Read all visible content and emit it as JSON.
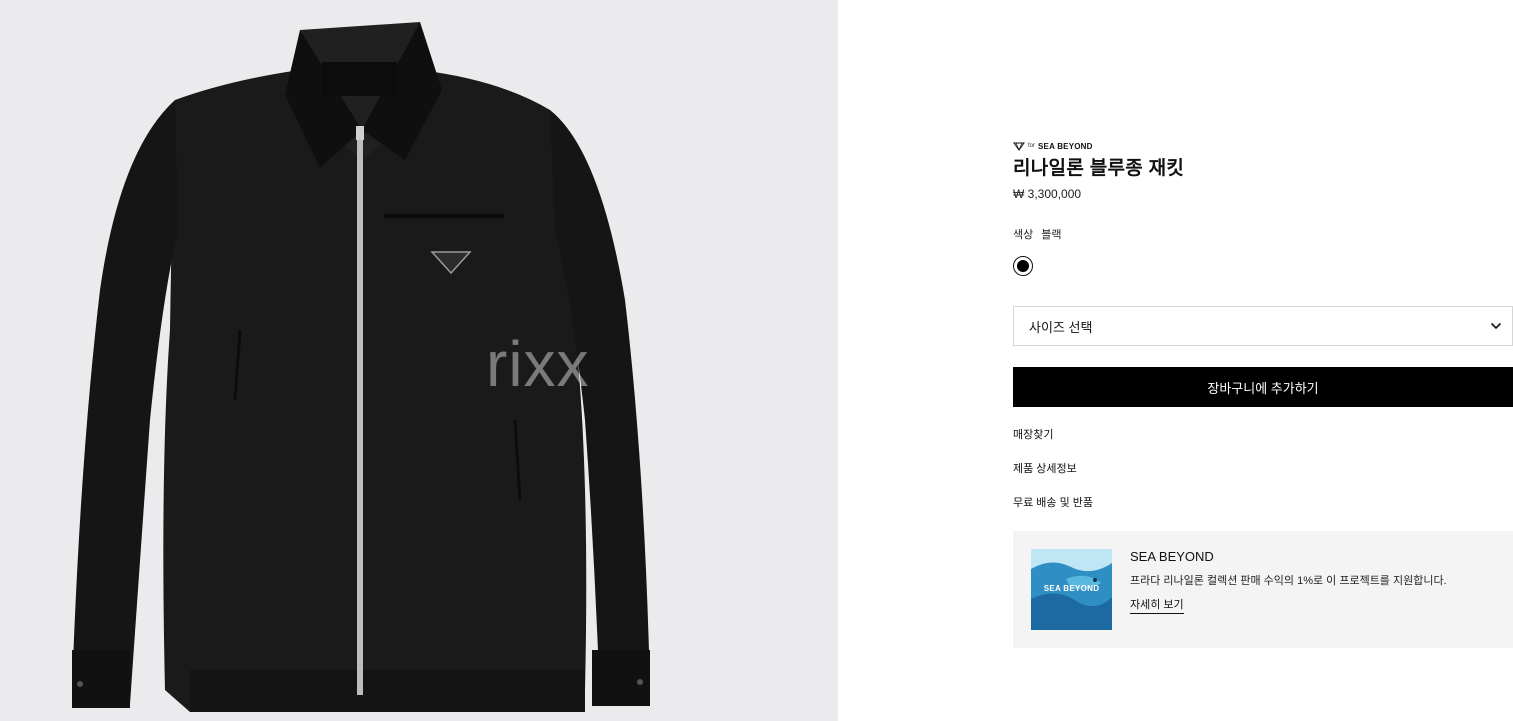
{
  "gallery": {
    "watermark": "rixx"
  },
  "product": {
    "tag_prefix": "for",
    "tag_name": "SEA BEYOND",
    "title": "리나일론 블루종 재킷",
    "price": "₩ 3,300,000",
    "color_label": "색상",
    "color_value": "블랙",
    "size_placeholder": "사이즈 선택",
    "add_to_cart": "장바구니에 추가하기"
  },
  "links": {
    "store_finder": "매장찾기",
    "product_details": "제품 상세정보",
    "shipping_returns": "무료 배송 및 반품"
  },
  "promo": {
    "image_label": "SEA BEYOND",
    "title": "SEA BEYOND",
    "description": "프라다 리나일론 컬렉션 판매 수익의 1%로 이 프로젝트를 지원합니다.",
    "link": "자세히 보기"
  },
  "colors": {
    "primary": "#000000",
    "background": "#ffffff",
    "gallery_background": "#ebebed",
    "promo_background": "#f4f4f4"
  }
}
